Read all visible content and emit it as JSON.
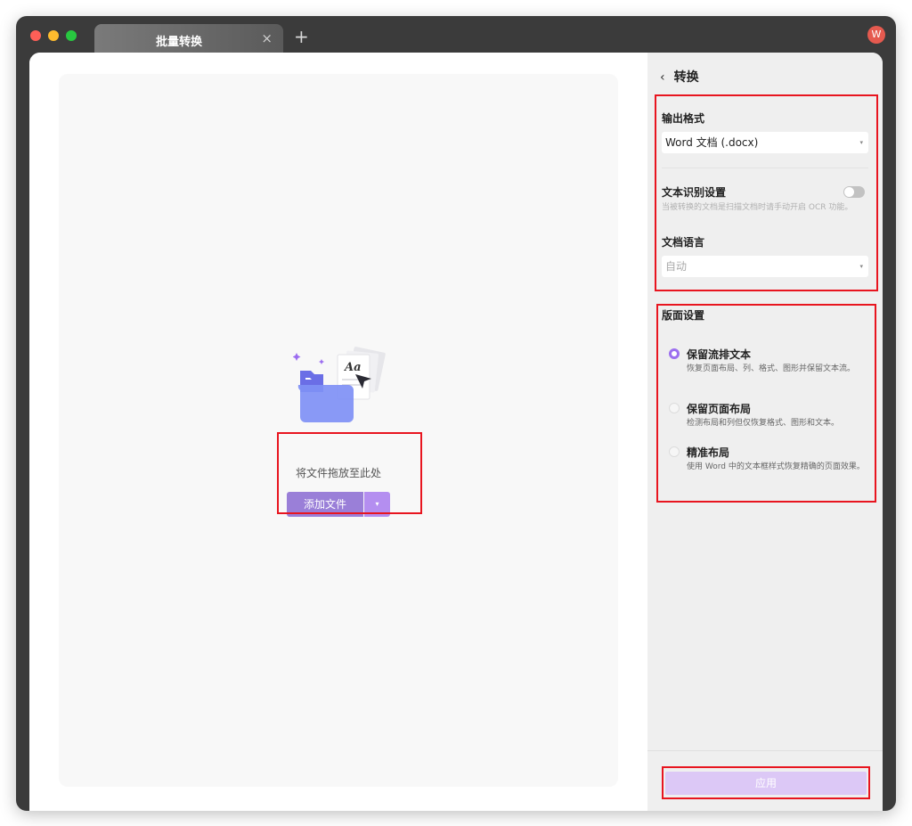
{
  "tab": {
    "title": "批量转换",
    "close": "×",
    "new": "+"
  },
  "user": {
    "avatar_letter": "W"
  },
  "dropzone": {
    "label": "将文件拖放至此处",
    "add_button": "添加文件",
    "dropdown_caret": "▾",
    "illustration_text": "Aa"
  },
  "panel": {
    "back": "‹",
    "title": "转换",
    "output_format": {
      "label": "输出格式",
      "value": "Word 文档 (.docx)"
    },
    "ocr": {
      "label": "文本识别设置",
      "hint": "当被转换的文档是扫描文档时请手动开启 OCR 功能。",
      "enabled": false
    },
    "language": {
      "label": "文档语言",
      "value": "自动"
    },
    "layout": {
      "label": "版面设置",
      "options": [
        {
          "title": "保留流排文本",
          "desc": "恢复页面布局、列、格式、图形并保留文本流。",
          "selected": true
        },
        {
          "title": "保留页面布局",
          "desc": "检测布局和列但仅恢复格式、图形和文本。",
          "selected": false
        },
        {
          "title": "精准布局",
          "desc": "使用 Word 中的文本框样式恢复精确的页面效果。",
          "selected": false
        }
      ]
    },
    "apply": "应用",
    "select_caret": "▾"
  },
  "colors": {
    "accent": "#9c6fef",
    "highlight": "#e8151f",
    "apply_disabled": "#dcc8f6"
  }
}
